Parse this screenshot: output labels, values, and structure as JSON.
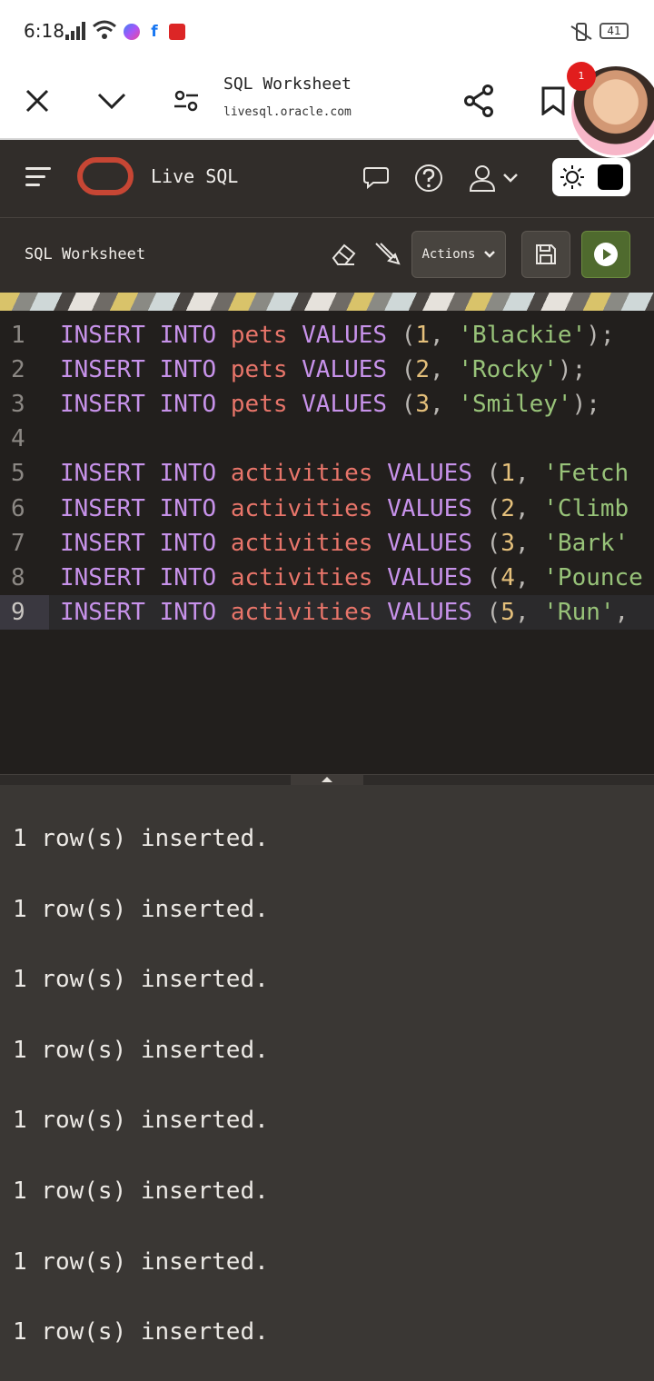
{
  "status_bar": {
    "time": "6:18",
    "battery": "41"
  },
  "browser": {
    "title": "SQL Worksheet",
    "url": "livesql.oracle.com",
    "chat_badge": "1"
  },
  "app": {
    "name": "Live SQL"
  },
  "toolbar": {
    "title": "SQL Worksheet",
    "actions_label": "Actions"
  },
  "editor": {
    "lines": [
      {
        "n": "1",
        "kw1": "INSERT",
        "kw2": "INTO",
        "table": "pets",
        "kw3": "VALUES",
        "open": "(",
        "num": "1",
        "comma": ",",
        "str": "'Blackie'",
        "tail": ");"
      },
      {
        "n": "2",
        "kw1": "INSERT",
        "kw2": "INTO",
        "table": "pets",
        "kw3": "VALUES",
        "open": "(",
        "num": "2",
        "comma": ",",
        "str": "'Rocky'",
        "tail": ");"
      },
      {
        "n": "3",
        "kw1": "INSERT",
        "kw2": "INTO",
        "table": "pets",
        "kw3": "VALUES",
        "open": "(",
        "num": "3",
        "comma": ",",
        "str": "'Smiley'",
        "tail": ");"
      },
      {
        "n": "4",
        "kw1": "",
        "kw2": "",
        "table": "",
        "kw3": "",
        "open": "",
        "num": "",
        "comma": "",
        "str": "",
        "tail": ""
      },
      {
        "n": "5",
        "kw1": "INSERT",
        "kw2": "INTO",
        "table": "activities",
        "kw3": "VALUES",
        "open": "(",
        "num": "1",
        "comma": ",",
        "str": "'Fetch",
        "tail": ""
      },
      {
        "n": "6",
        "kw1": "INSERT",
        "kw2": "INTO",
        "table": "activities",
        "kw3": "VALUES",
        "open": "(",
        "num": "2",
        "comma": ",",
        "str": "'Climb",
        "tail": ""
      },
      {
        "n": "7",
        "kw1": "INSERT",
        "kw2": "INTO",
        "table": "activities",
        "kw3": "VALUES",
        "open": "(",
        "num": "3",
        "comma": ",",
        "str": "'Bark'",
        "tail": ""
      },
      {
        "n": "8",
        "kw1": "INSERT",
        "kw2": "INTO",
        "table": "activities",
        "kw3": "VALUES",
        "open": "(",
        "num": "4",
        "comma": ",",
        "str": "'Pounce",
        "tail": ""
      },
      {
        "n": "9",
        "kw1": "INSERT",
        "kw2": "INTO",
        "table": "activities",
        "kw3": "VALUES",
        "open": "(",
        "num": "5",
        "comma": ",",
        "str": "'Run'",
        "tail": ","
      }
    ],
    "active_line": "9"
  },
  "output": {
    "messages": [
      "1 row(s) inserted.",
      "1 row(s) inserted.",
      "1 row(s) inserted.",
      "1 row(s) inserted.",
      "1 row(s) inserted.",
      "1 row(s) inserted.",
      "1 row(s) inserted.",
      "1 row(s) inserted."
    ]
  },
  "colors": {
    "header_bg": "#312d2a",
    "editor_bg": "#221f1d",
    "output_bg": "#3a3734",
    "oracle_red": "#c74634",
    "run_green": "#4f6a2e",
    "keyword": "#c792ea",
    "table_name": "#e8756a",
    "number": "#e5c07b",
    "string": "#98c379"
  },
  "icons": [
    "close-icon",
    "chevron-down-icon",
    "tune-icon",
    "share-icon",
    "bookmark-icon",
    "menu-icon",
    "oracle-logo",
    "chat-icon",
    "help-icon",
    "user-icon",
    "sun-icon",
    "eraser-icon",
    "format-icon",
    "save-icon",
    "play-icon"
  ]
}
